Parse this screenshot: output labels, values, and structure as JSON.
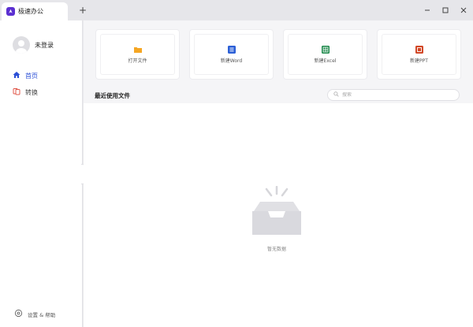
{
  "window": {
    "tab_title": "极速办公",
    "new_tab_label": "+"
  },
  "sidebar": {
    "user_name": "未登录",
    "items": [
      {
        "label": "首页",
        "icon": "home-icon"
      },
      {
        "label": "转换",
        "icon": "convert-icon"
      }
    ],
    "settings_label": "设置 & 帮助"
  },
  "quick_actions": [
    {
      "label": "打开文件",
      "icon": "folder-icon",
      "color": "#f5a623"
    },
    {
      "label": "新建Word",
      "icon": "word-icon",
      "color": "#2b5fd6"
    },
    {
      "label": "新建Excel",
      "icon": "excel-icon",
      "color": "#1f8a4c"
    },
    {
      "label": "新建PPT",
      "icon": "ppt-icon",
      "color": "#d24726"
    }
  ],
  "recent": {
    "title": "最近使用文件",
    "search_placeholder": "搜索",
    "empty_text": "暂无数据"
  },
  "colors": {
    "accent": "#2b4fd6",
    "brand": "#5b2fd1"
  }
}
